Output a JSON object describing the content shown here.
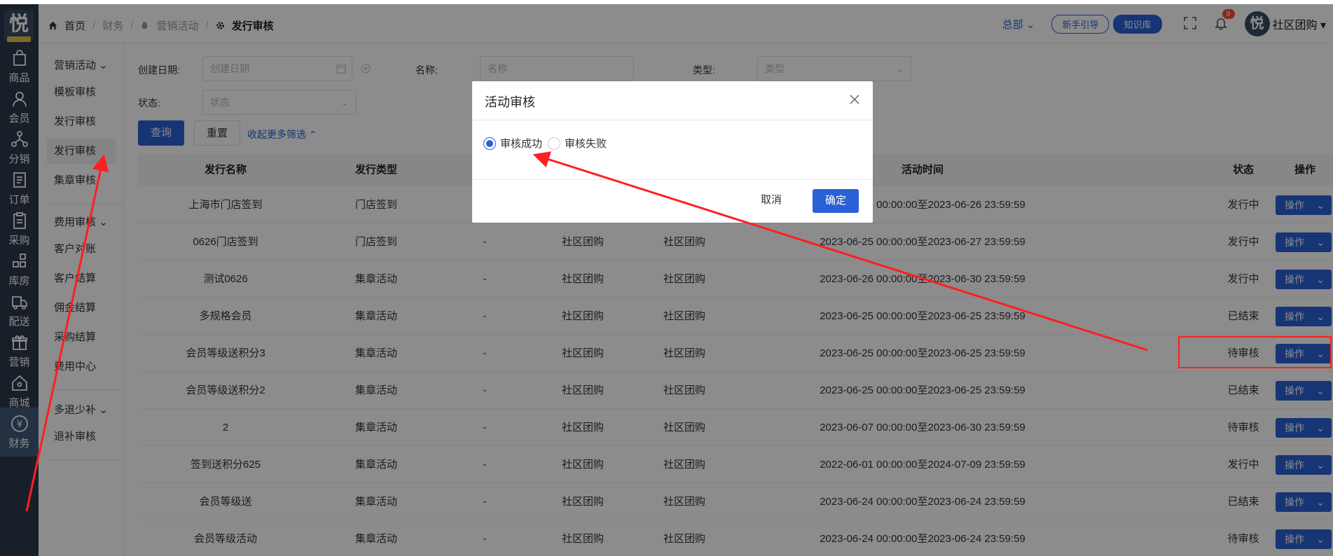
{
  "nav": {
    "logo": "悦",
    "items": [
      {
        "label": "商品",
        "icon": "shopping-bag-icon"
      },
      {
        "label": "会员",
        "icon": "user-icon"
      },
      {
        "label": "分销",
        "icon": "share-network-icon"
      },
      {
        "label": "订单",
        "icon": "order-doc-icon"
      },
      {
        "label": "采购",
        "icon": "clipboard-icon"
      },
      {
        "label": "库房",
        "icon": "warehouse-grid-icon"
      },
      {
        "label": "配送",
        "icon": "truck-icon"
      },
      {
        "label": "营销",
        "icon": "gift-icon"
      },
      {
        "label": "商城",
        "icon": "home-icon"
      },
      {
        "label": "财务",
        "icon": "yuan-icon"
      }
    ]
  },
  "breadcrumb": {
    "home": "首页",
    "finance": "财务",
    "marketing": "营销活动",
    "current": "发行审核"
  },
  "header": {
    "org": "总部",
    "guide": "新手引导",
    "kb": "知识库",
    "notif_count": "9",
    "user": "社区团购"
  },
  "submenu": {
    "group1": "营销活动",
    "g1_items": [
      "模板审核",
      "发行审核",
      "发行审核",
      "集章审核"
    ],
    "group2": "费用审核",
    "g2_items": [
      "客户对账",
      "客户结算",
      "佣金结算",
      "采购结算",
      "费用中心"
    ],
    "group3": "多退少补",
    "g3_items": [
      "退补审核"
    ]
  },
  "filters": {
    "created_label": "创建日期:",
    "created_placeholder": "创建日期",
    "name_label": "名称:",
    "name_placeholder": "名称",
    "type_label": "类型:",
    "type_placeholder": "类型",
    "status_label": "状态:",
    "status_placeholder": "状态",
    "query": "查询",
    "reset": "重置",
    "collapse": "收起更多筛选"
  },
  "table": {
    "headers": {
      "name": "发行名称",
      "type": "发行类型",
      "time": "活动时间",
      "status": "状态",
      "op": "操作"
    },
    "op_label": "操作",
    "rows": [
      {
        "name": "上海市门店签到",
        "type": "门店签到",
        "c3": "",
        "c4": "",
        "c5": "",
        "time": "2023-06-26 00:00:00至2023-06-26 23:59:59",
        "status": "发行中"
      },
      {
        "name": "0626门店签到",
        "type": "门店签到",
        "c3": "-",
        "c4": "社区团购",
        "c5": "社区团购",
        "time": "2023-06-25 00:00:00至2023-06-27 23:59:59",
        "status": "发行中"
      },
      {
        "name": "测试0626",
        "type": "集章活动",
        "c3": "-",
        "c4": "社区团购",
        "c5": "社区团购",
        "time": "2023-06-26 00:00:00至2023-06-30 23:59:59",
        "status": "发行中"
      },
      {
        "name": "多规格会员",
        "type": "集章活动",
        "c3": "-",
        "c4": "社区团购",
        "c5": "社区团购",
        "time": "2023-06-25 00:00:00至2023-06-25 23:59:59",
        "status": "已结束"
      },
      {
        "name": "会员等级送积分3",
        "type": "集章活动",
        "c3": "-",
        "c4": "社区团购",
        "c5": "社区团购",
        "time": "2023-06-25 00:00:00至2023-06-25 23:59:59",
        "status": "待审核"
      },
      {
        "name": "会员等级送积分2",
        "type": "集章活动",
        "c3": "-",
        "c4": "社区团购",
        "c5": "社区团购",
        "time": "2023-06-25 00:00:00至2023-06-25 23:59:59",
        "status": "已结束"
      },
      {
        "name": "2",
        "type": "集章活动",
        "c3": "-",
        "c4": "社区团购",
        "c5": "社区团购",
        "time": "2023-06-07 00:00:00至2023-06-30 23:59:59",
        "status": "待审核"
      },
      {
        "name": "签到送积分625",
        "type": "集章活动",
        "c3": "-",
        "c4": "社区团购",
        "c5": "社区团购",
        "time": "2022-06-01 00:00:00至2024-07-09 23:59:59",
        "status": "发行中"
      },
      {
        "name": "会员等级送",
        "type": "集章活动",
        "c3": "-",
        "c4": "社区团购",
        "c5": "社区团购",
        "time": "2023-06-24 00:00:00至2023-06-24 23:59:59",
        "status": "已结束"
      },
      {
        "name": "会员等级活动",
        "type": "集章活动",
        "c3": "-",
        "c4": "社区团购",
        "c5": "社区团购",
        "time": "2023-06-24 00:00:00至2023-06-24 23:59:59",
        "status": "待审核"
      }
    ]
  },
  "dialog": {
    "title": "活动审核",
    "option_success": "审核成功",
    "option_fail": "审核失败",
    "selected": "审核成功",
    "cancel": "取消",
    "ok": "确定"
  },
  "annotation_color": "#ff1f1f",
  "primary_color": "#2b61d6"
}
